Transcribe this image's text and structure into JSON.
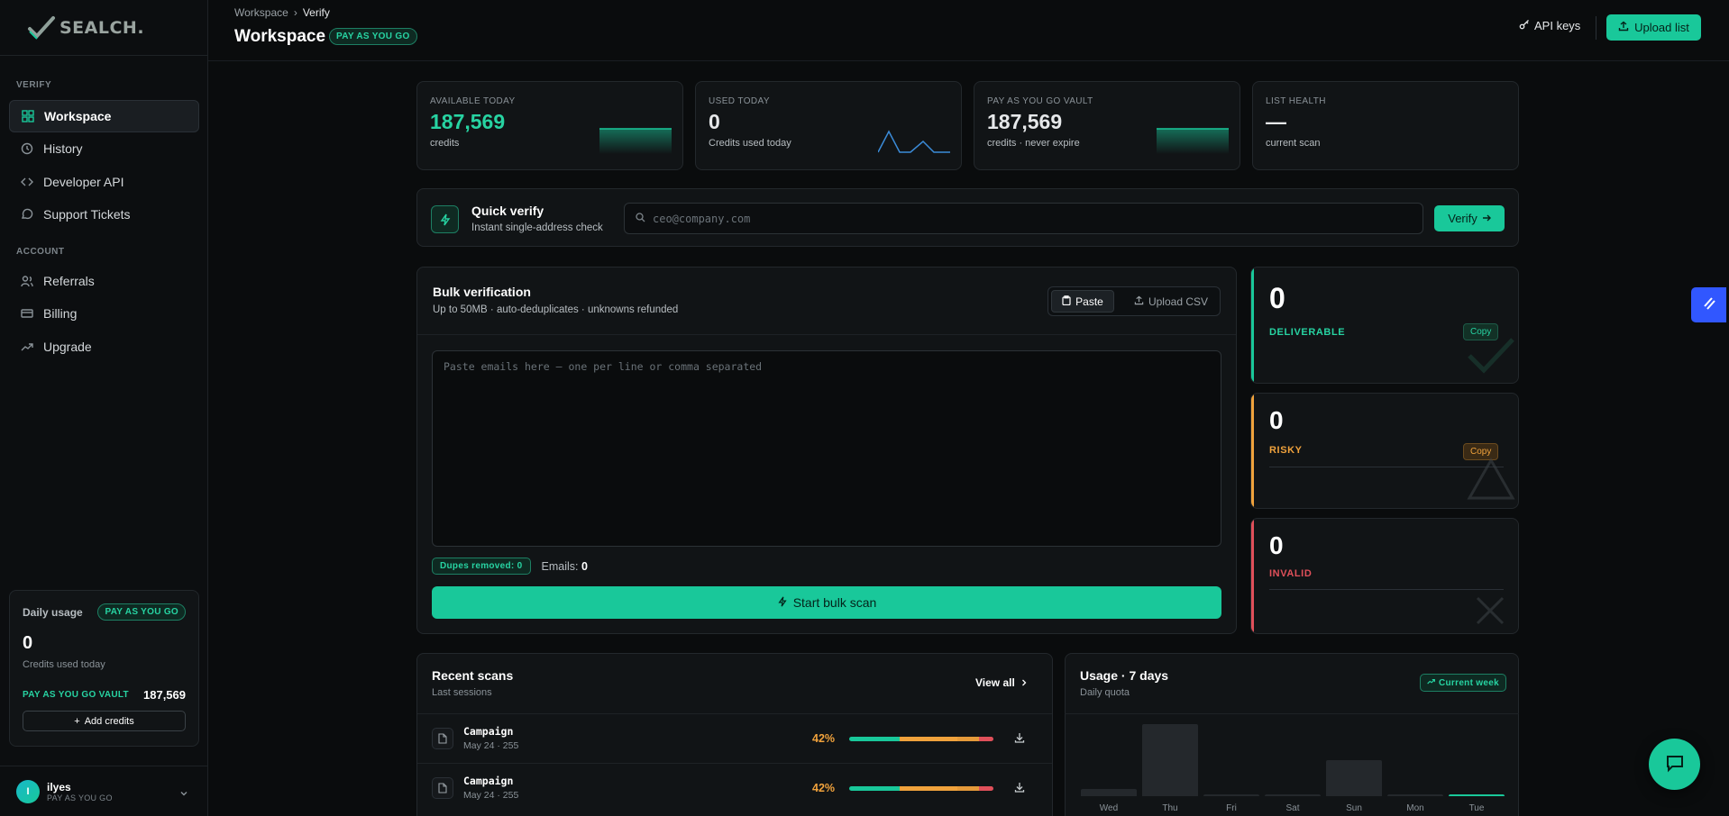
{
  "brand": {
    "name": "SEALCH."
  },
  "sidebar": {
    "section_verify": "VERIFY",
    "section_account": "ACCOUNT",
    "items": [
      {
        "label": "Workspace",
        "icon": "grid-icon"
      },
      {
        "label": "History",
        "icon": "history-icon"
      },
      {
        "label": "Developer API",
        "icon": "code-icon"
      },
      {
        "label": "Support Tickets",
        "icon": "chat-icon"
      },
      {
        "label": "Referrals",
        "icon": "users-icon"
      },
      {
        "label": "Billing",
        "icon": "card-icon"
      },
      {
        "label": "Upgrade",
        "icon": "trend-up-icon"
      }
    ],
    "usage": {
      "title": "Daily usage",
      "plan_badge": "PAY AS YOU GO",
      "value": "0",
      "sub": "Credits used today",
      "vault_label": "PAY AS YOU GO VAULT",
      "vault_value": "187,569",
      "add_credits": "Add credits"
    },
    "user": {
      "initial": "I",
      "name": "ilyes",
      "plan": "PAY AS YOU GO"
    }
  },
  "header": {
    "breadcrumb": [
      "Workspace",
      "Verify"
    ],
    "title": "Workspace",
    "plan_badge": "PAY AS YOU GO",
    "api_keys": "API keys",
    "upload_list": "Upload list"
  },
  "stats": [
    {
      "label": "AVAILABLE TODAY",
      "value": "187,569",
      "sub": "credits"
    },
    {
      "label": "USED TODAY",
      "value": "0",
      "sub": "Credits used today"
    },
    {
      "label": "PAY AS YOU GO VAULT",
      "value": "187,569",
      "sub": "credits · never expire"
    },
    {
      "label": "LIST HEALTH",
      "value": "—",
      "sub": "current scan"
    }
  ],
  "quick_verify": {
    "title": "Quick verify",
    "sub": "Instant single-address check",
    "placeholder": "ceo@company.com",
    "button": "Verify"
  },
  "bulk": {
    "title": "Bulk verification",
    "sub": "Up to 50MB · auto-deduplicates · unknowns refunded",
    "tab_paste": "Paste",
    "tab_upload": "Upload CSV",
    "placeholder": "Paste emails here — one per line or comma separated",
    "dupes_label": "Dupes removed:",
    "dupes_value": "0",
    "emails_label": "Emails:",
    "emails_value": "0",
    "start": "Start bulk scan"
  },
  "results": [
    {
      "value": "0",
      "label": "DELIVERABLE",
      "copy": "Copy",
      "color": "#19c89a"
    },
    {
      "value": "0",
      "label": "RISKY",
      "copy": "Copy",
      "color": "#f0a23c"
    },
    {
      "value": "0",
      "label": "INVALID",
      "color": "#e0505a"
    }
  ],
  "recent": {
    "title": "Recent scans",
    "sub": "Last sessions",
    "view_all": "View all",
    "rows": [
      {
        "name": "Campaign",
        "meta": "May 24 · 255",
        "percent": "42%",
        "segments": [
          0.35,
          0.4,
          0.15,
          0.1
        ]
      },
      {
        "name": "Campaign",
        "meta": "May 24 · 255",
        "percent": "42%",
        "segments": [
          0.35,
          0.4,
          0.15,
          0.1
        ]
      }
    ]
  },
  "usage_chart": {
    "title": "Usage · 7 days",
    "sub": "Daily quota",
    "badge": "Current week",
    "chart_data": {
      "type": "bar",
      "categories": [
        "Wed",
        "Thu",
        "Fri",
        "Sat",
        "Sun",
        "Mon",
        "Tue"
      ],
      "values": [
        8,
        80,
        2,
        2,
        40,
        2,
        2
      ],
      "highlight_index": 6
    }
  },
  "colors": {
    "accent": "#19c89a",
    "risky": "#f0a23c",
    "invalid": "#e0505a",
    "sparkline": "#3b8bd8"
  }
}
